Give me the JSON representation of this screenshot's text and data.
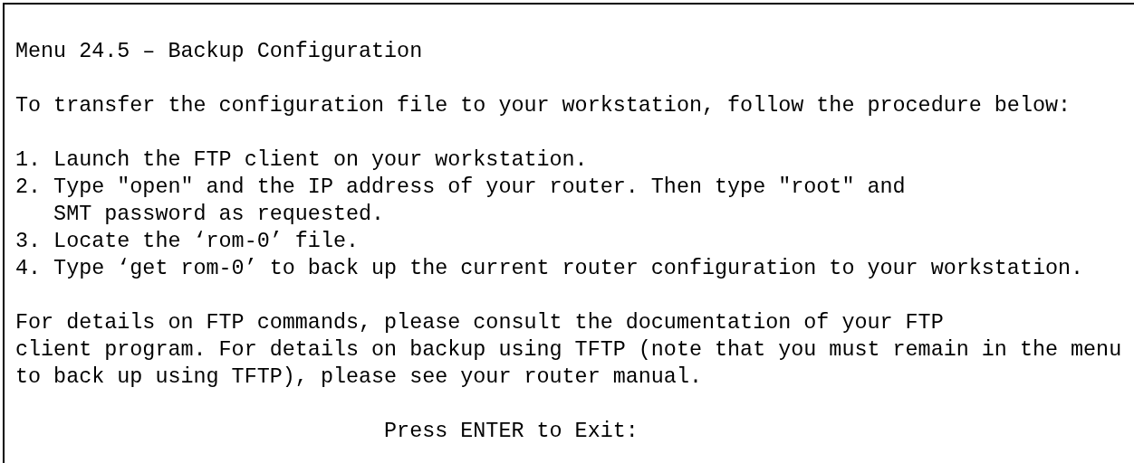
{
  "title": "Menu 24.5 – Backup Configuration",
  "intro": "To transfer the configuration file to your workstation, follow the procedure below:",
  "steps": [
    {
      "number": "1.",
      "lines": [
        "Launch the FTP client on your workstation."
      ]
    },
    {
      "number": "2.",
      "lines": [
        "Type \"open\" and the IP address of your router. Then type \"root\" and",
        "SMT password as requested."
      ]
    },
    {
      "number": "3.",
      "lines": [
        "Locate the ‘rom-0’ file."
      ]
    },
    {
      "number": "4.",
      "lines": [
        "Type ‘get rom-0’ to back up the current router configuration to your workstation."
      ]
    }
  ],
  "note": [
    "For details on FTP commands, please consult the documentation of your FTP",
    "client program. For details on backup using TFTP (note that you must remain in the menu",
    "to back up using TFTP), please see your router manual."
  ],
  "prompt": "Press ENTER to Exit:"
}
